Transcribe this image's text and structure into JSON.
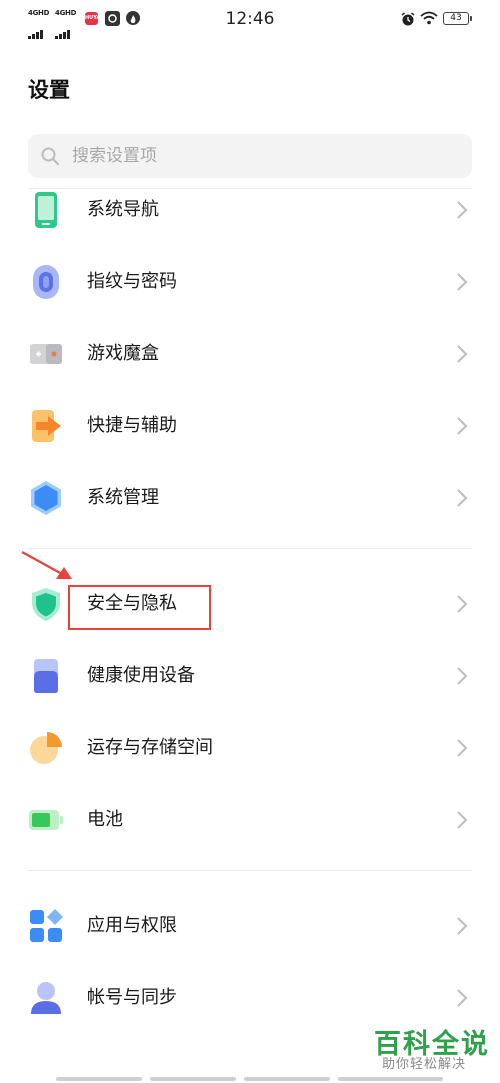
{
  "status_bar": {
    "sim1": "4GHD",
    "sim2": "4GHD",
    "time": "12:46",
    "battery": "43",
    "app_badge": "HUYA"
  },
  "page": {
    "title": "设置"
  },
  "search": {
    "placeholder": "搜索设置项"
  },
  "items": [
    {
      "label": "系统导航",
      "icon": "phone-navigation-icon"
    },
    {
      "label": "指纹与密码",
      "icon": "fingerprint-icon"
    },
    {
      "label": "游戏魔盒",
      "icon": "game-box-icon"
    },
    {
      "label": "快捷与辅助",
      "icon": "shortcut-arrow-icon"
    },
    {
      "label": "系统管理",
      "icon": "hexagon-icon"
    },
    {
      "label": "安全与隐私",
      "icon": "shield-icon"
    },
    {
      "label": "健康使用设备",
      "icon": "health-device-icon"
    },
    {
      "label": "运存与存储空间",
      "icon": "pie-storage-icon"
    },
    {
      "label": "电池",
      "icon": "battery-icon"
    },
    {
      "label": "应用与权限",
      "icon": "apps-grid-icon"
    },
    {
      "label": "帐号与同步",
      "icon": "account-person-icon"
    }
  ],
  "watermark": {
    "logo": "百科全说",
    "tagline": "助你轻松解决"
  },
  "colors": {
    "highlight": "#e8423f",
    "watermark": "#2fa14b"
  }
}
